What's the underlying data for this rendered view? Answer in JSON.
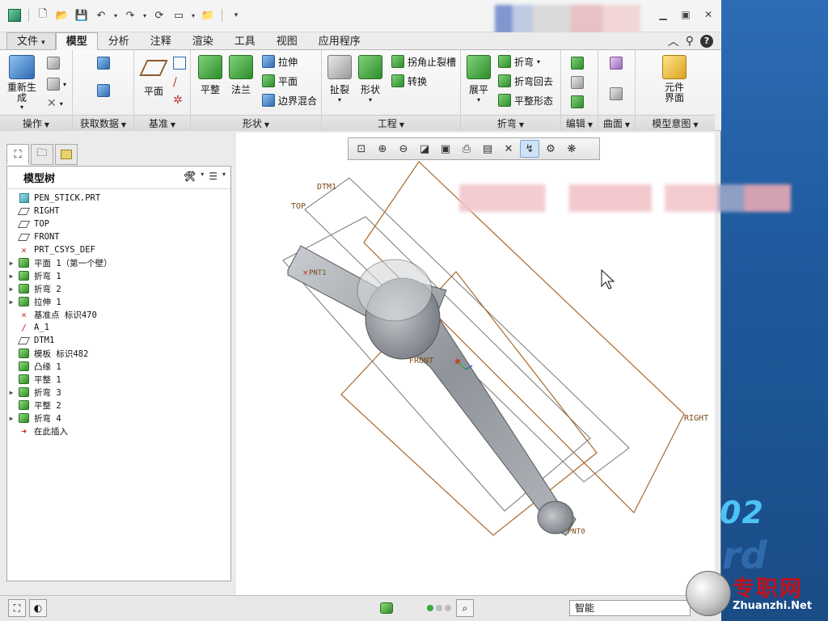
{
  "app": {
    "quick_access": [
      "new-icon",
      "open-icon",
      "save-icon",
      "undo-icon",
      "redo-icon",
      "regenerate-icon",
      "window-icon",
      "folder-icon",
      "customize-icon"
    ]
  },
  "tabs": [
    {
      "label": "文件",
      "dropdown": "▾"
    },
    {
      "label": "模型"
    },
    {
      "label": "分析"
    },
    {
      "label": "注释"
    },
    {
      "label": "渲染"
    },
    {
      "label": "工具"
    },
    {
      "label": "视图"
    },
    {
      "label": "应用程序"
    }
  ],
  "ribbon": {
    "groups": {
      "operations": "操作",
      "get_data": "获取数据",
      "datum": "基准",
      "shape": "形状",
      "engineering": "工程",
      "bend": "折弯",
      "edit": "编辑",
      "surface": "曲面",
      "model_intent": "模型意图"
    },
    "buttons": {
      "regenerate": "重新生成",
      "plane": "平面",
      "flat": "平整",
      "flange": "法兰",
      "extrude": "拉伸",
      "planar": "平面",
      "boundary_blend": "边界混合",
      "rip": "扯裂",
      "form": "形状",
      "corner_relief": "拐角止裂槽",
      "convert": "转换",
      "unbend": "展平",
      "bend": "折弯",
      "bend_back": "折弯回去",
      "flat_state": "平整形态",
      "component_interface": "元件界面"
    }
  },
  "model_tree": {
    "title": "模型树",
    "items": [
      {
        "label": "PEN_STICK.PRT",
        "icon": "part-icon",
        "expander": ""
      },
      {
        "label": "RIGHT",
        "icon": "datum-plane-icon",
        "expander": ""
      },
      {
        "label": "TOP",
        "icon": "datum-plane-icon",
        "expander": ""
      },
      {
        "label": "FRONT",
        "icon": "datum-plane-icon",
        "expander": ""
      },
      {
        "label": "PRT_CSYS_DEF",
        "icon": "csys-icon",
        "expander": ""
      },
      {
        "label": "平面 1（第一个壁）",
        "icon": "flat-wall-icon",
        "expander": "▶"
      },
      {
        "label": "折弯 1",
        "icon": "bend-icon",
        "expander": "▶"
      },
      {
        "label": "折弯 2",
        "icon": "bend-icon",
        "expander": "▶"
      },
      {
        "label": "拉伸 1",
        "icon": "extrude-icon",
        "expander": "▶"
      },
      {
        "label": "基准点 标识470",
        "icon": "datum-point-icon",
        "expander": ""
      },
      {
        "label": "A_1",
        "icon": "axis-icon",
        "expander": ""
      },
      {
        "label": "DTM1",
        "icon": "datum-plane-icon",
        "expander": ""
      },
      {
        "label": "模板 标识482",
        "icon": "template-icon",
        "expander": ""
      },
      {
        "label": "凸缘 1",
        "icon": "flange-icon",
        "expander": ""
      },
      {
        "label": "平整 1",
        "icon": "flat-wall-icon",
        "expander": ""
      },
      {
        "label": "折弯 3",
        "icon": "bend-icon",
        "expander": "▶"
      },
      {
        "label": "平整 2",
        "icon": "flat-wall-icon",
        "expander": ""
      },
      {
        "label": "折弯 4",
        "icon": "bend-icon",
        "expander": "▶"
      },
      {
        "label": "在此插入",
        "icon": "insert-here-icon",
        "expander": ""
      }
    ]
  },
  "viewport": {
    "datum_labels": {
      "dtm1": "DTM1",
      "top": "TOP",
      "front": "FRONT",
      "right": "RIGHT",
      "pnt1": "PNT1",
      "pnt0": "PNT0"
    }
  },
  "status_bar": {
    "filter_value": "智能"
  },
  "overlay": {
    "version_text": "02",
    "partial_text": "rd",
    "watermark_cn": "专职网",
    "watermark_url": "Zhuanzhi.Net"
  }
}
